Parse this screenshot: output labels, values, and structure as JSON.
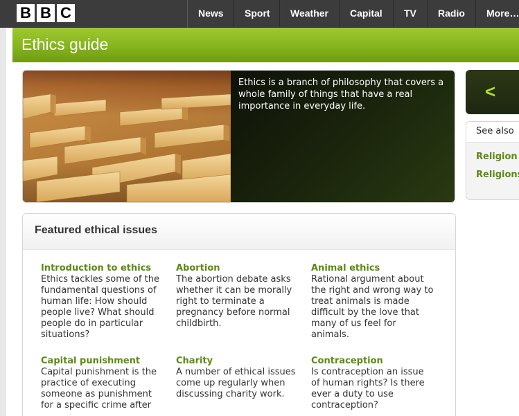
{
  "header": {
    "logo_letters": [
      "B",
      "B",
      "C"
    ],
    "nav": [
      "News",
      "Sport",
      "Weather",
      "Capital",
      "TV",
      "Radio",
      "More…"
    ]
  },
  "banner": {
    "title": "Ethics guide"
  },
  "hero": {
    "text": "Ethics is a branch of philosophy that covers a whole family of things that have a real importance in everyday life."
  },
  "carousel": {
    "arrow": "<"
  },
  "see_also": {
    "heading": "See also",
    "links": [
      "Religion a",
      "Religions"
    ]
  },
  "featured": {
    "heading": "Featured ethical issues",
    "items": [
      {
        "title": "Introduction to ethics",
        "desc": "Ethics tackles some of the fundamental questions of human life: How should people live? What should people do in particular situations?"
      },
      {
        "title": "Abortion",
        "desc": "The abortion debate asks whether it can be morally right to terminate a pregnancy before normal childbirth."
      },
      {
        "title": "Animal ethics",
        "desc": "Rational argument about the right and wrong way to treat animals is made difficult by the love that many of us feel for animals."
      },
      {
        "title": "Capital punishment",
        "desc": "Capital punishment is the practice of executing someone as punishment for a specific crime after"
      },
      {
        "title": "Charity",
        "desc": "A number of ethical issues come up regularly when discussing charity work."
      },
      {
        "title": "Contraception",
        "desc": "Is contraception an issue of human rights? Is there ever a duty to use contraception?"
      }
    ]
  },
  "colors": {
    "accent_green": "#85b41c",
    "link_green": "#5b8a11",
    "topbar": "#3c3c3c"
  }
}
